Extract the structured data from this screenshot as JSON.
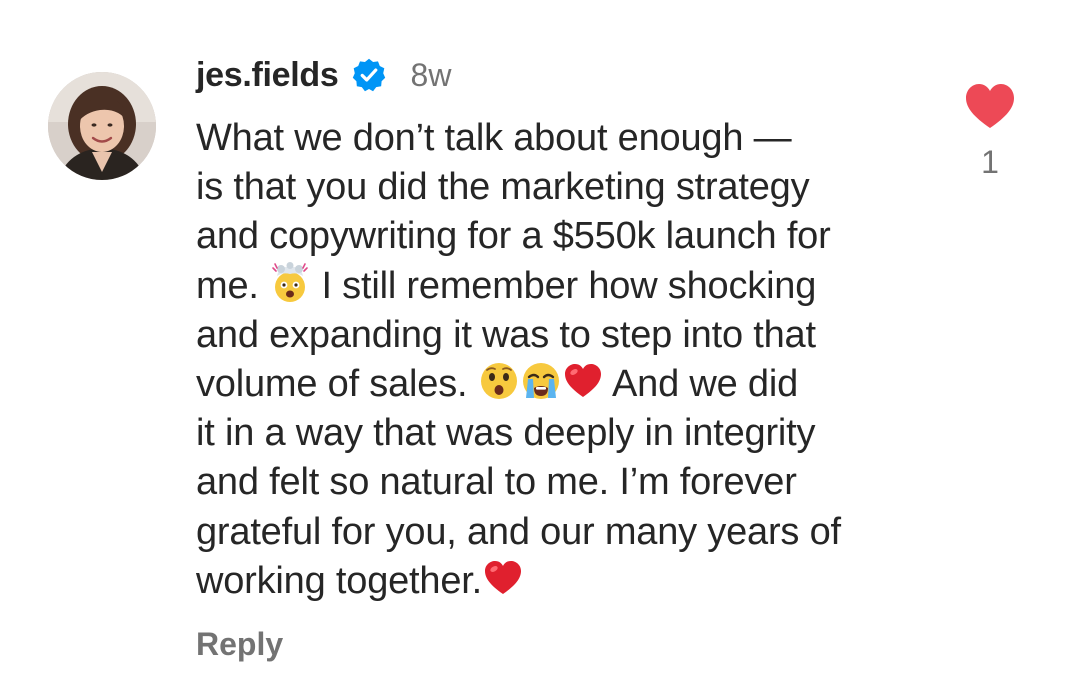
{
  "comment": {
    "username": "jes.fields",
    "verified": true,
    "time": "8w",
    "lines": [
      {
        "text": "What we don’t talk about enough —"
      },
      {
        "text": "is that you did the marketing strategy"
      },
      {
        "text": "and copywriting for a $550k launch for"
      },
      {
        "before": "me. ",
        "emoji": "exploding-head-emoji",
        "after": " I still remember how shocking"
      },
      {
        "text": "and expanding it was to step into that"
      },
      {
        "before": "volume of sales. ",
        "emojis": [
          "astonished-face-emoji",
          "crying-face-emoji",
          "red-heart-emoji"
        ],
        "after": " And we did"
      },
      {
        "text": "it in a way that was deeply in integrity"
      },
      {
        "text": "and felt so natural to me. I’m forever"
      },
      {
        "text": "grateful for you, and our many years of"
      },
      {
        "before": "working together.",
        "emoji": "red-heart-emoji"
      }
    ],
    "reply_label": "Reply",
    "like_count": "1"
  },
  "colors": {
    "heart": "#ed4956",
    "verified": "#0095f6",
    "secondary_text": "#737373",
    "primary_text": "#262626"
  }
}
